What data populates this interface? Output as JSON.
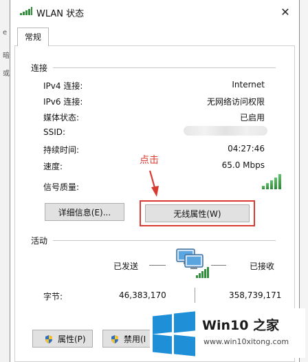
{
  "background": {
    "fragments": [
      "e",
      "暗",
      "或"
    ]
  },
  "window": {
    "title": "WLAN 状态",
    "close_glyph": "✕"
  },
  "tabs": [
    {
      "label": "常规"
    }
  ],
  "connection": {
    "group_label": "连接",
    "rows": [
      {
        "label": "IPv4 连接:",
        "value": "Internet"
      },
      {
        "label": "IPv6 连接:",
        "value": "无网络访问权限"
      },
      {
        "label": "媒体状态:",
        "value": "已启用"
      },
      {
        "label": "SSID:",
        "value": ""
      },
      {
        "label": "持续时间:",
        "value": "04:27:46"
      },
      {
        "label": "速度:",
        "value": "65.0 Mbps"
      },
      {
        "label": "信号质量:",
        "value": ""
      }
    ],
    "signal_level": 5,
    "signal_max": 5
  },
  "buttons": {
    "details": "详细信息(E)...",
    "wireless_props": "无线属性(W)",
    "properties": "属性(P)",
    "disable": "禁用(I"
  },
  "annotation": {
    "text": "点击",
    "color": "#e03a2e"
  },
  "activity": {
    "group_label": "活动",
    "sent_label": "已发送",
    "received_label": "已接收",
    "bytes_label": "字节:",
    "bytes_sent": "46,383,170",
    "bytes_received": "358,739,171"
  },
  "watermark": {
    "title": "Win10 之家",
    "url": "www.win10xitong.com"
  },
  "colors": {
    "accent": "#1f8fd8",
    "signal_green": "#2f8f3a",
    "highlight_red": "#d63a30"
  },
  "icons": [
    "wifi-icon",
    "close-icon",
    "signal-strength-icon",
    "network-computer-icon",
    "shield-icon",
    "windows-logo-icon"
  ]
}
